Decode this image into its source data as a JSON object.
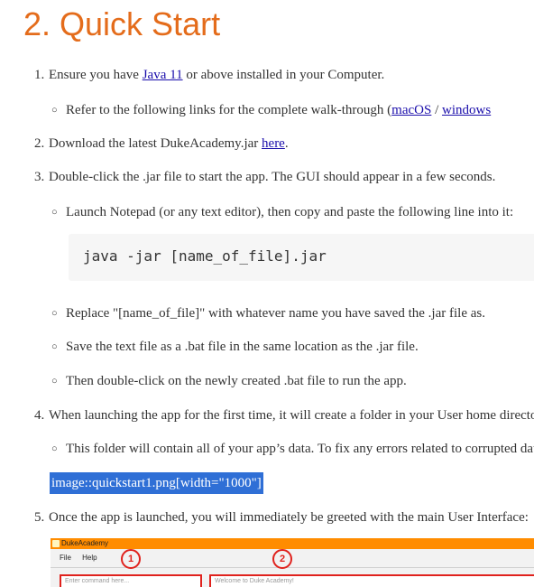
{
  "heading": "2. Quick Start",
  "steps": {
    "s1_num": "1.",
    "s1_pre": "Ensure you have ",
    "s1_link": "Java 11",
    "s1_post": " or above installed in your Computer.",
    "s1a_pre": "Refer to the following links for the complete walk-through (",
    "s1a_link1": "macOS",
    "s1a_sep": " / ",
    "s1a_link2": "windows",
    "s2_num": "2.",
    "s2_pre": "Download the latest DukeAcademy.jar ",
    "s2_link": "here",
    "s2_post": ".",
    "s3_num": "3.",
    "s3_text": "Double-click the .jar file to start the app. The GUI should appear in a few seconds.",
    "s3a_text": "Launch Notepad (or any text editor), then copy and paste the following line into it:",
    "code": "java -jar [name_of_file].jar",
    "s3b_text": "Replace \"[name_of_file]\" with whatever name you have saved the .jar file as.",
    "s3c_text": "Save the text file as a .bat file in the same location as the .jar file.",
    "s3d_text": "Then double-click on the newly created .bat file to run the app.",
    "s4_num": "4.",
    "s4_text": "When launching the app for the first time, it will create a folder in your User home directory.",
    "s4a_text": "This folder will contain all of your app’s data. To fix any errors related to corrupted data,",
    "image_macro": "image::quickstart1.png[width=\"1000\"]",
    "s5_num": "5.",
    "s5_text": "Once the app is launched, you will immediately be greeted with the main User Interface:"
  },
  "screenshot": {
    "app_title": "DukeAcademy",
    "menu_file": "File",
    "menu_help": "Help",
    "callout1": "1",
    "callout2": "2",
    "command_placeholder": "Enter command here...",
    "welcome_text": "Welcome to Duke Academy!"
  },
  "colors": {
    "heading": "#e46c1b",
    "link": "#1a0dab",
    "highlight": "#2f6fd6",
    "app_bar": "#ff8c00",
    "callout": "#e0221d"
  }
}
